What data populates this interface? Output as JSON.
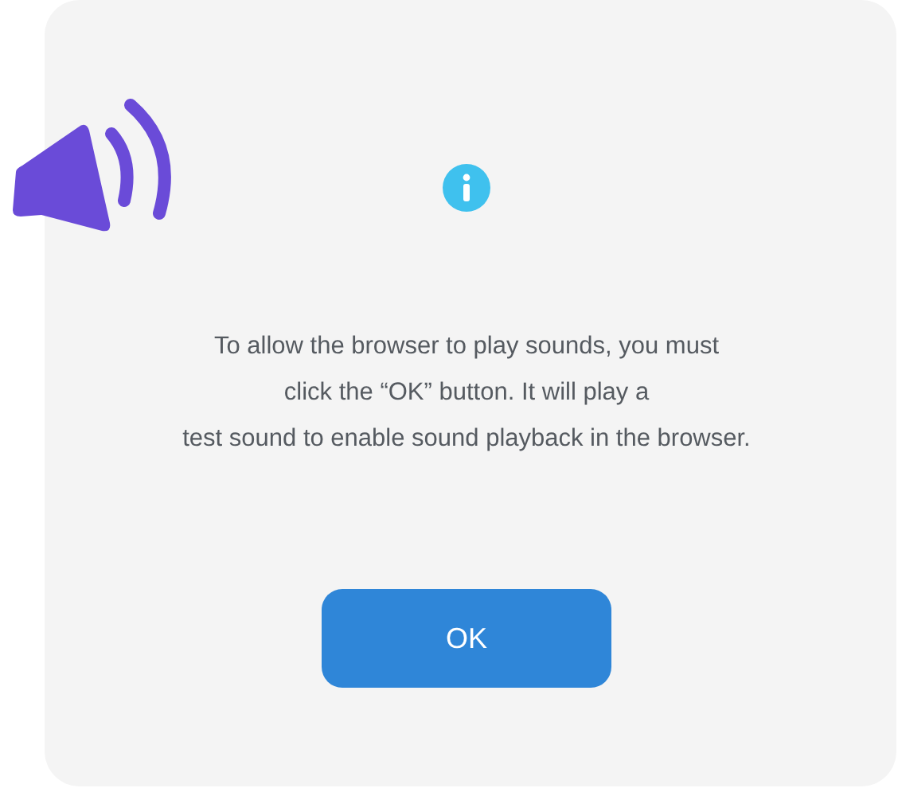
{
  "dialog": {
    "message_lines": [
      "To allow the browser to play sounds, you must",
      "click the “OK” button. It will play a",
      "test sound to enable sound playback in the browser."
    ],
    "button": {
      "label": "OK"
    }
  }
}
